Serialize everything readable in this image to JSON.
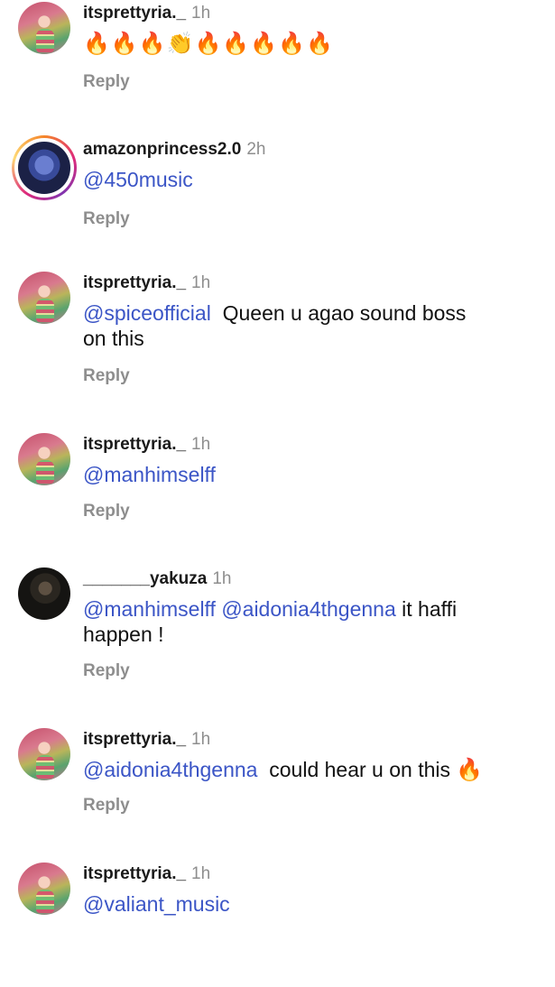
{
  "comments": [
    {
      "username": "itsprettyria._",
      "time": "1h",
      "emojis": "🔥🔥🔥👏🔥🔥🔥🔥🔥",
      "reply": "Reply"
    },
    {
      "username": "amazonprincess2.0",
      "time": "2h",
      "mention1": "@450music",
      "reply": "Reply"
    },
    {
      "username": "itsprettyria._",
      "time": "1h",
      "mention1": "@spiceofficial",
      "text_part1": "Queen u agao sound boss",
      "text_part2": "on this",
      "reply": "Reply"
    },
    {
      "username": "itsprettyria._",
      "time": "1h",
      "mention1": "@manhimselff",
      "reply": "Reply"
    },
    {
      "username": "_______yakuza",
      "time": "1h",
      "mention1": "@manhimselff",
      "mention2": "@aidonia4thgenna",
      "text_part1": "it haffi",
      "text_part2": "happen !",
      "reply": "Reply"
    },
    {
      "username": "itsprettyria._",
      "time": "1h",
      "mention1": "@aidonia4thgenna",
      "text_part1": "could hear u on this",
      "emoji": "🔥",
      "reply": "Reply"
    },
    {
      "username": "itsprettyria._",
      "time": "1h",
      "mention1": "@valiant_music"
    }
  ],
  "colors": {
    "mention": "#3b55c6",
    "meta": "#8e8e8e"
  }
}
